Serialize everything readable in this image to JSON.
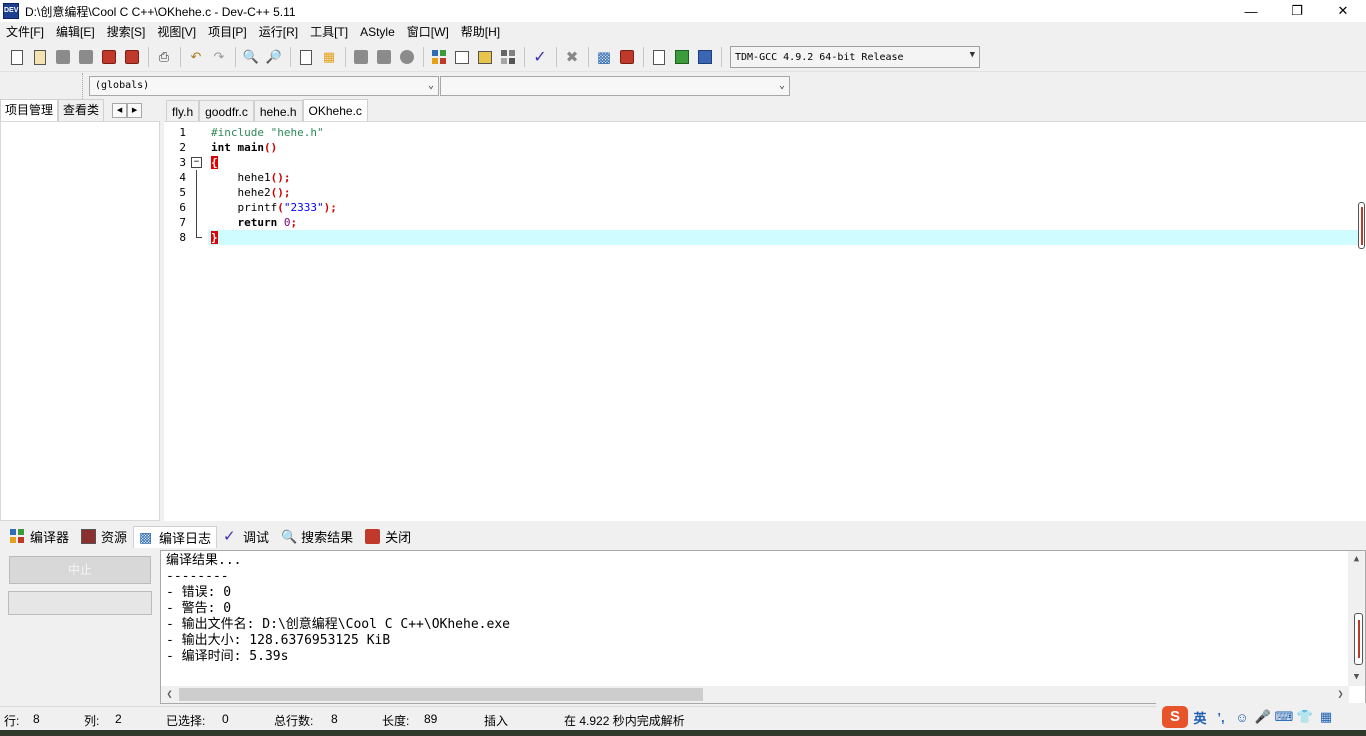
{
  "window": {
    "title": "D:\\创意编程\\Cool C C++\\OKhehe.c - Dev-C++ 5.11",
    "icon_text": "DEV",
    "controls": [
      "minimize-icon",
      "maximize-icon",
      "close-icon"
    ]
  },
  "menu": [
    "文件[F]",
    "编辑[E]",
    "搜索[S]",
    "视图[V]",
    "项目[P]",
    "运行[R]",
    "工具[T]",
    "AStyle",
    "窗口[W]",
    "帮助[H]"
  ],
  "toolbar": {
    "compiler": "TDM-GCC 4.9.2 64-bit Release"
  },
  "scope": {
    "globals": "(globals)",
    "members": ""
  },
  "left_tabs": [
    "项目管理",
    "查看类"
  ],
  "editor_tabs": [
    "fly.h",
    "goodfr.c",
    "hehe.h",
    "OKhehe.c"
  ],
  "active_editor_tab": "OKhehe.c",
  "code": {
    "line_numbers": [
      "1",
      "2",
      "3",
      "4",
      "5",
      "6",
      "7",
      "8"
    ],
    "l1": "#include \"hehe.h\"",
    "l2_kw": "int",
    "l2_rest": " main",
    "l2_sym": "()",
    "l3": "{",
    "l4_a": "    hehe1",
    "l4_b": "();",
    "l5_a": "    hehe2",
    "l5_b": "();",
    "l6_a": "    printf",
    "l6_b": "(",
    "l6_str": "\"2333\"",
    "l6_c": ");",
    "l7_kw": "    return",
    "l7_sp": " ",
    "l7_num": "0",
    "l7_c": ";",
    "l8": "}"
  },
  "bottom_tabs": [
    "编译器",
    "资源",
    "编译日志",
    "调试",
    "搜索结果",
    "关闭"
  ],
  "active_bottom_tab": "编译日志",
  "compile_panel": {
    "stop_label": "中止",
    "log": [
      "编译结果...",
      "--------",
      "- 错误: 0",
      "- 警告: 0",
      "- 输出文件名: D:\\创意编程\\Cool C C++\\OKhehe.exe",
      "- 输出大小: 128.6376953125 KiB",
      "- 编译时间: 5.39s"
    ]
  },
  "status": {
    "row_label": "行:",
    "row_value": "8",
    "col_label": "列:",
    "col_value": "2",
    "sel_label": "已选择:",
    "sel_value": "0",
    "total_label": "总行数:",
    "total_value": "8",
    "len_label": "长度:",
    "len_value": "89",
    "mode": "插入",
    "parse_msg": "在 4.922 秒内完成解析"
  },
  "tray": {
    "ime_logo": "S",
    "ime_lang": "英"
  }
}
